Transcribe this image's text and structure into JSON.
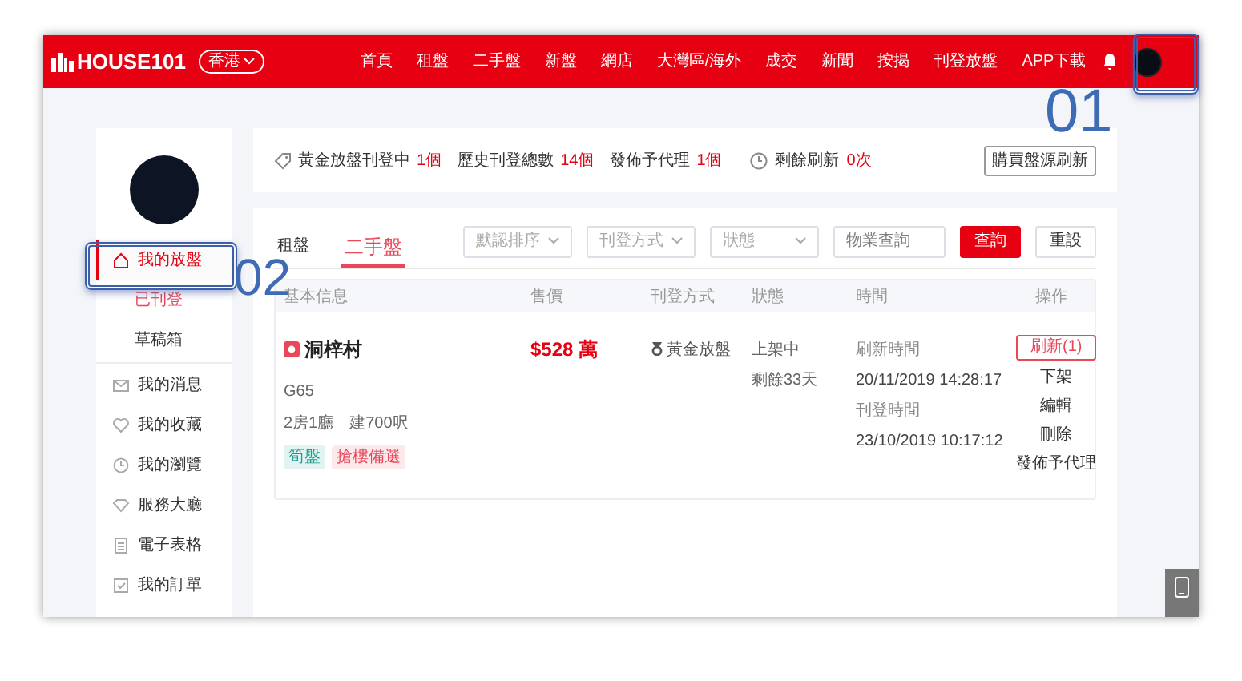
{
  "nav": {
    "logo": "HOUSE101",
    "region": "香港",
    "links": [
      {
        "label": "首頁",
        "selected": false
      },
      {
        "label": "租盤",
        "selected": false
      },
      {
        "label": "二手盤",
        "selected": false
      },
      {
        "label": "新盤",
        "selected": false
      },
      {
        "label": "網店",
        "selected": false
      },
      {
        "label": "大灣區/海外",
        "selected": false
      },
      {
        "label": "成交",
        "selected": false
      },
      {
        "label": "新聞",
        "selected": false
      },
      {
        "label": "按揭",
        "selected": false
      },
      {
        "label": "刊登放盤",
        "selected": false
      },
      {
        "label": "APP下載",
        "selected": false
      }
    ]
  },
  "sidebar": {
    "items": [
      {
        "label": "我的放盤",
        "selected": true,
        "children": [
          {
            "label": "已刊登",
            "selected": true
          },
          {
            "label": "草稿箱",
            "selected": false
          }
        ]
      },
      {
        "label": "我的消息",
        "selected": false
      },
      {
        "label": "我的收藏",
        "selected": false
      },
      {
        "label": "我的瀏覽",
        "selected": false
      },
      {
        "label": "服務大廳",
        "selected": false
      },
      {
        "label": "電子表格",
        "selected": false
      },
      {
        "label": "我的訂單",
        "selected": false
      }
    ]
  },
  "stats": {
    "items": [
      {
        "label": "黃金放盤刊登中",
        "value": "1個"
      },
      {
        "label": "歷史刊登總數",
        "value": "14個"
      },
      {
        "label": "發佈予代理",
        "value": "1個"
      }
    ],
    "refresh": {
      "label": "剩餘刷新",
      "value": "0次"
    },
    "button": "購買盤源刷新"
  },
  "tabs": [
    {
      "label": "租盤",
      "selected": false
    },
    {
      "label": "二手盤",
      "selected": true
    }
  ],
  "filters": {
    "dropdowns": [
      "默認排序",
      "刊登方式",
      "狀態"
    ],
    "search": {
      "placeholder": "物業查詢"
    },
    "buttons": [
      {
        "label": "查詢",
        "kind": "primary"
      },
      {
        "label": "重設",
        "kind": "secondary"
      }
    ]
  },
  "table": {
    "columns": [
      "基本信息",
      "售價",
      "刊登方式",
      "狀態",
      "時間",
      "操作"
    ],
    "rows": [
      {
        "name": "洞梓村",
        "code": "G65",
        "layout": "2房1廳",
        "area": "建700呎",
        "tags": [
          {
            "label": "筍盤",
            "color": "#1a9e8f"
          },
          {
            "label": "搶樓備選",
            "color": "#e8485a"
          }
        ],
        "price": "$528 萬",
        "method": "黃金放盤",
        "status": [
          "上架中",
          "剩餘33天"
        ],
        "times": [
          {
            "label": "刷新時間",
            "value": "20/11/2019 14:28:17"
          },
          {
            "label": "刊登時間",
            "value": "23/10/2019 10:17:12"
          }
        ],
        "actions": [
          {
            "label": "刷新(1)",
            "kind": "outlined"
          },
          {
            "label": "下架",
            "kind": "plain"
          },
          {
            "label": "編輯",
            "kind": "plain"
          },
          {
            "label": "刪除",
            "kind": "plain"
          },
          {
            "label": "發佈予代理",
            "kind": "plain"
          }
        ]
      }
    ]
  },
  "annotations": [
    {
      "label": "01"
    },
    {
      "label": "02"
    }
  ]
}
